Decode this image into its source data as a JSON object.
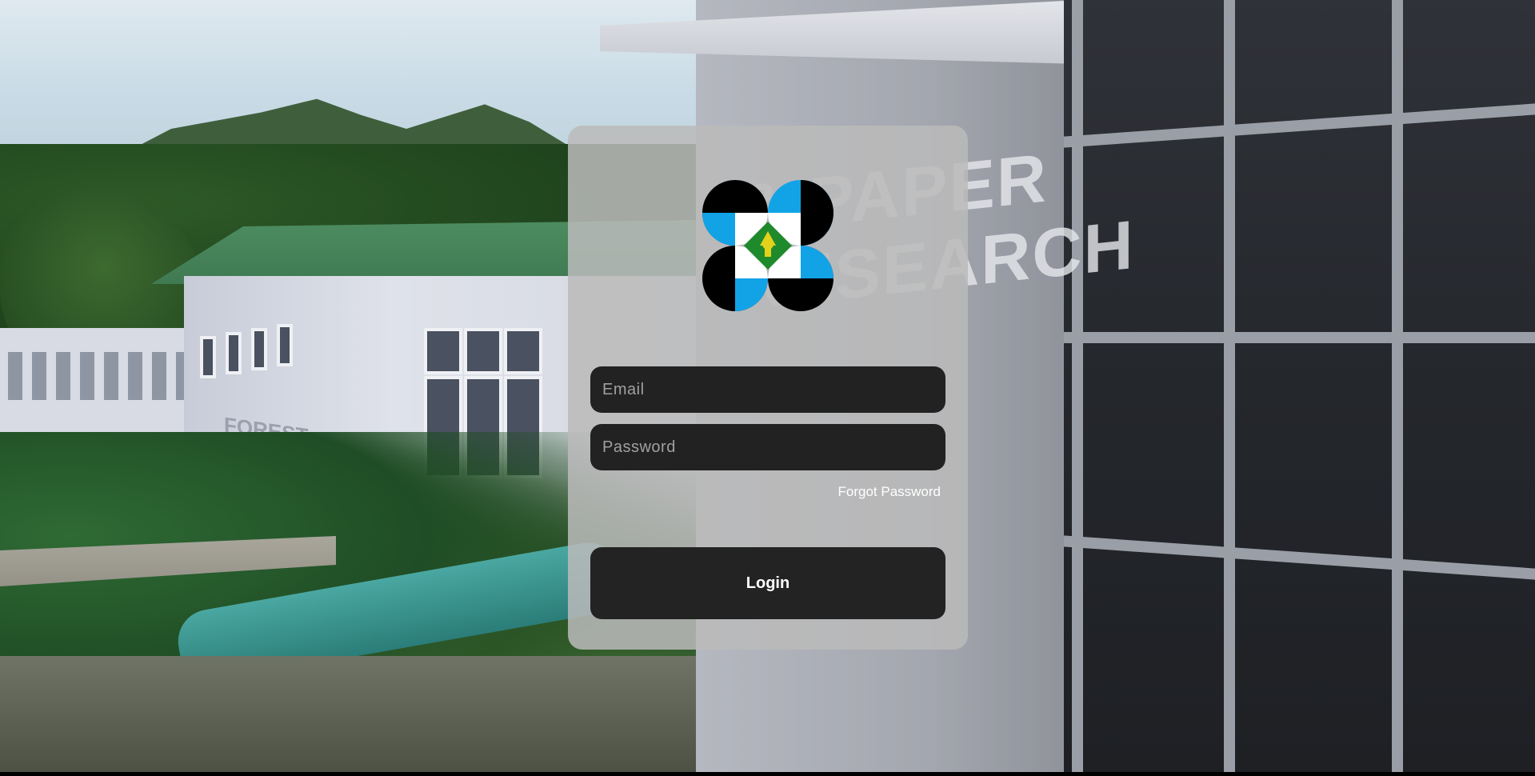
{
  "login": {
    "email_placeholder": "Email",
    "password_placeholder": "Password",
    "forgot_password_label": "Forgot Password",
    "login_button_label": "Login"
  },
  "background": {
    "sign_main": "& PAPER\nRESEARCH",
    "sign_small": "FOREST\nPRODUCTS\nLABORATORY"
  },
  "colors": {
    "card_background": "#bababa",
    "input_background": "#222222",
    "button_background": "#232323",
    "logo_blue": "#12a3e6",
    "logo_green": "#1f8a2b",
    "logo_yellow": "#e3d21b"
  },
  "icons": {
    "logo": "agency-logo-icon"
  }
}
